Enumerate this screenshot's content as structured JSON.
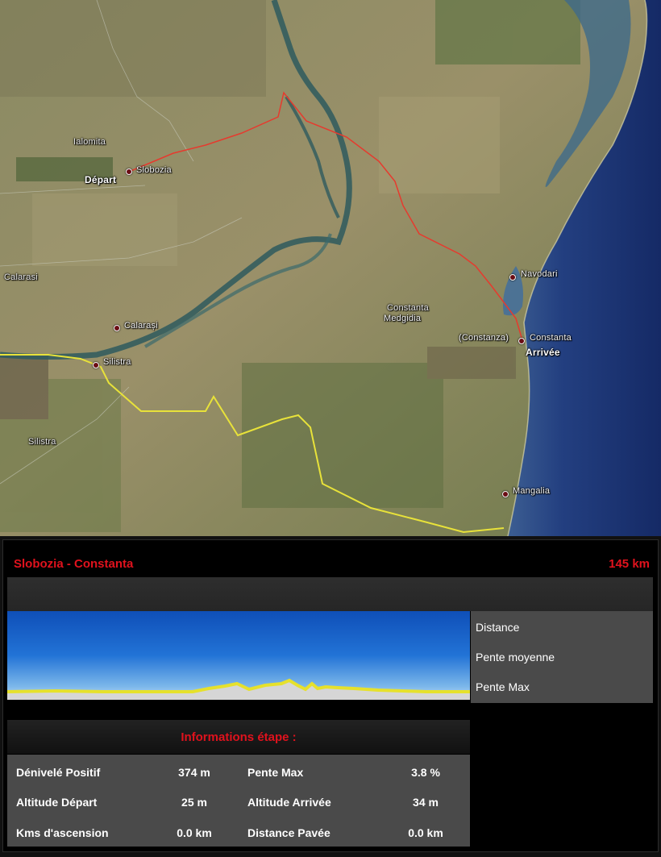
{
  "map": {
    "regions": {
      "ialomita": "Ialomita",
      "calarasi_region": "Calarasi",
      "silistra_region": "Silistra",
      "constanta_region": "Constanta"
    },
    "cities": {
      "slobozia": "Slobozia",
      "calarasi": "Calarași",
      "silistra": "Silistra",
      "medgidia": "Medgidia",
      "navodari": "Navodari",
      "constanta_paren": "(Constanza)",
      "constanta": "Constanta",
      "mangalia": "Mangalia"
    },
    "roles": {
      "start": "Départ",
      "finish": "Arrivée"
    },
    "colors": {
      "route": "#e63a2e",
      "border": "#e8e23a",
      "sea": "#1f3c7a"
    }
  },
  "panel": {
    "title": "Slobozia - Constanta",
    "distance": "145 km",
    "legend": [
      "Distance",
      "Pente moyenne",
      "Pente Max"
    ],
    "info_title": "Informations étape :",
    "rows": [
      {
        "label1": "Dénivelé Positif",
        "value1": "374 m",
        "label2": "Pente Max",
        "value2": "3.8 %"
      },
      {
        "label1": "Altitude Départ",
        "value1": "25 m",
        "label2": "Altitude Arrivée",
        "value2": "34 m"
      },
      {
        "label1": "Kms d'ascension",
        "value1": "0.0 km",
        "label2": "Distance Pavée",
        "value2": "0.0 km"
      }
    ],
    "colors": {
      "accent": "#e0121d",
      "profile_line": "#e6e12c"
    }
  }
}
